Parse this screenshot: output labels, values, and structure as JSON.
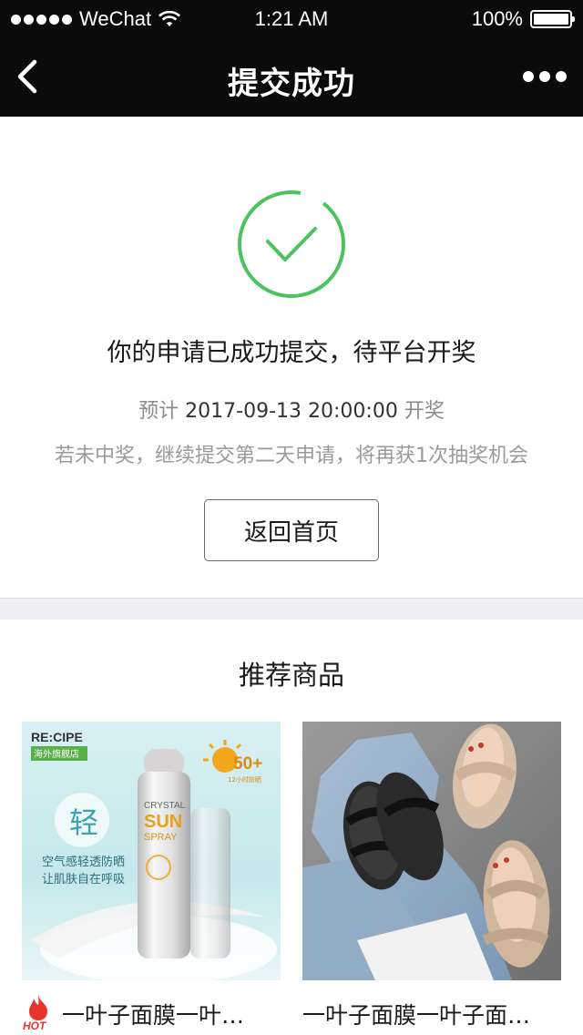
{
  "status_bar": {
    "carrier": "WeChat",
    "time": "1:21 AM",
    "battery": "100%"
  },
  "nav": {
    "title": "提交成功",
    "back_icon": "chevron-left-icon",
    "more_icon": "more-dots-icon"
  },
  "result": {
    "message": "你的申请已成功提交，待平台开奖",
    "expect_prefix": "预计",
    "expect_datetime": "2017-09-13 20:00:00",
    "expect_suffix": "开奖",
    "hint": "若未中奖，继续提交第二天申请，将再获1次抽奖机会",
    "home_button": "返回首页",
    "success_color": "#4cc35f"
  },
  "recommend": {
    "title": "推荐商品",
    "products": [
      {
        "name": "一叶子面膜一叶…",
        "badge": "HOT",
        "image": {
          "brand": "RE:CIPE",
          "store_tag": "海外旗舰店",
          "big_char": "轻",
          "line1": "空气感轻透防晒",
          "line2": "让肌肤自在呼吸",
          "spf": "50+",
          "spf_note": "12小时防晒",
          "can_text1": "CRYSTAL",
          "can_text2": "SUN",
          "can_text3": "SPRAY"
        }
      },
      {
        "name": "一叶子面膜一叶子面…"
      }
    ]
  }
}
